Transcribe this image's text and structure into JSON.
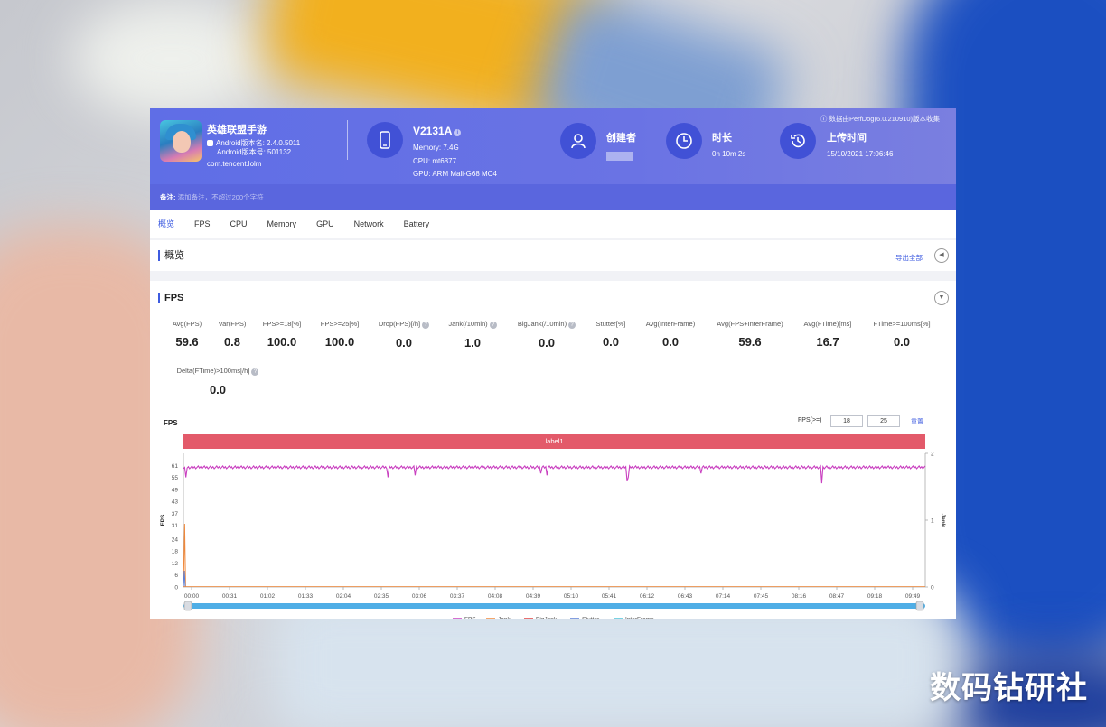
{
  "watermark": "数码钻研社",
  "app": {
    "name": "英雄联盟手游",
    "android_version": "Android版本名: 2.4.0.5011",
    "android_code": "Android版本号: 501132",
    "package": "com.tencent.lolm"
  },
  "device": {
    "name": "V2131A",
    "memory": "Memory: 7.4G",
    "cpu": "CPU: mt6877",
    "gpu": "GPU: ARM Mali-G68 MC4"
  },
  "creator": {
    "title": "创建者"
  },
  "duration": {
    "title": "时长",
    "value": "0h 10m 2s"
  },
  "upload": {
    "title": "上传时间",
    "value": "15/10/2021 17:06:46"
  },
  "version_note": "ⓘ 数据由PerfDog(6.0.210910)版本收集",
  "notes": {
    "label": "备注:",
    "placeholder": "添加备注，不超过200个字符"
  },
  "tabs": [
    "概览",
    "FPS",
    "CPU",
    "Memory",
    "GPU",
    "Network",
    "Battery"
  ],
  "overview": {
    "title": "概览",
    "export": "导出全部"
  },
  "fps_panel": {
    "title": "FPS",
    "metrics": [
      {
        "label": "Avg(FPS)",
        "value": "59.6"
      },
      {
        "label": "Var(FPS)",
        "value": "0.8"
      },
      {
        "label": "FPS>=18[%]",
        "value": "100.0"
      },
      {
        "label": "FPS>=25[%]",
        "value": "100.0"
      },
      {
        "label": "Drop(FPS)[/h]",
        "value": "0.0"
      },
      {
        "label": "Jank(/10min)",
        "value": "1.0"
      },
      {
        "label": "BigJank(/10min)",
        "value": "0.0"
      },
      {
        "label": "Stutter[%]",
        "value": "0.0"
      },
      {
        "label": "Avg(InterFrame)",
        "value": "0.0"
      },
      {
        "label": "Avg(FPS+InterFrame)",
        "value": "59.6"
      },
      {
        "label": "Avg(FTime)[ms]",
        "value": "16.7"
      },
      {
        "label": "FTime>=100ms[%]",
        "value": "0.0"
      },
      {
        "label": "Delta(FTime)>100ms[/h]",
        "value": "0.0"
      }
    ]
  },
  "chart_header": {
    "title": "FPS",
    "filter_label": "FPS(>=)",
    "threshold_1": "18",
    "threshold_2": "25",
    "reset": "重置",
    "label_bar": "label1"
  },
  "chart_data": {
    "type": "line",
    "ylabel": "FPS",
    "y2label": "Jank",
    "yticks": [
      0,
      6,
      12,
      18,
      24,
      31,
      37,
      43,
      49,
      55,
      61
    ],
    "y2ticks": [
      0,
      1,
      2
    ],
    "ylim": [
      0,
      67
    ],
    "y2lim": [
      0,
      2
    ],
    "xticks": [
      "00:00",
      "00:31",
      "01:02",
      "01:33",
      "02:04",
      "02:35",
      "03:06",
      "03:37",
      "04:08",
      "04:39",
      "05:10",
      "05:41",
      "06:12",
      "06:43",
      "07:14",
      "07:45",
      "08:16",
      "08:47",
      "09:18",
      "09:49"
    ],
    "duration_sec": 602,
    "fps_baseline": 60,
    "fps_dips": [
      {
        "t": 2,
        "fps": 55
      },
      {
        "t": 166,
        "fps": 55
      },
      {
        "t": 188,
        "fps": 56
      },
      {
        "t": 290,
        "fps": 57
      },
      {
        "t": 295,
        "fps": 56
      },
      {
        "t": 360,
        "fps": 53
      },
      {
        "t": 361,
        "fps": 55
      },
      {
        "t": 420,
        "fps": 57
      },
      {
        "t": 518,
        "fps": 52
      }
    ],
    "jank_events": [
      {
        "t": 1,
        "value": 1
      }
    ],
    "legend_position": "bottom",
    "series": [
      {
        "name": "FPS",
        "color": "#c940c0"
      },
      {
        "name": "Jank",
        "color": "#f0883a"
      },
      {
        "name": "BigJank",
        "color": "#e04040"
      },
      {
        "name": "Stutter",
        "color": "#5b7fd6"
      },
      {
        "name": "InterFrame",
        "color": "#4cc3d8"
      }
    ]
  }
}
